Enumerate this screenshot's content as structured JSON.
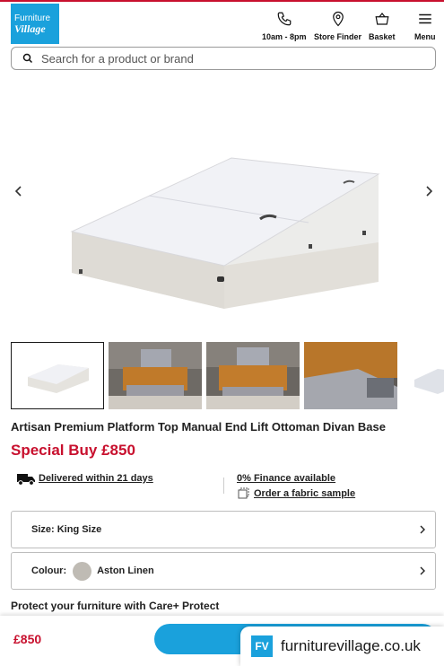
{
  "header": {
    "logo_line1": "Furniture",
    "logo_line2": "Village",
    "phone_label": "10am - 8pm",
    "store_label": "Store Finder",
    "basket_label": "Basket",
    "menu_label": "Menu"
  },
  "search": {
    "placeholder": "Search for a product or brand"
  },
  "product": {
    "title": "Artisan Premium Platform Top Manual End Lift Ottoman Divan Base",
    "price": "Special Buy £850"
  },
  "info": {
    "delivery": "Delivered within 21 days",
    "finance": "0% Finance available",
    "sample": "Order a fabric sample"
  },
  "options": {
    "size": "Size: King Size",
    "colour_label": "Colour:",
    "colour_value": "Aston Linen"
  },
  "protect": "Protect your furniture with Care+ Protect",
  "bottom_bar": {
    "price": "£850"
  },
  "watermark": {
    "badge": "FV",
    "text": "furniturevillage.co.uk"
  },
  "icons": {
    "phone": "phone-icon",
    "store": "location-pin-icon",
    "basket": "basket-icon",
    "menu": "hamburger-menu-icon",
    "search": "search-icon",
    "delivery": "delivery-truck-icon",
    "sample": "fabric-sample-icon"
  },
  "colors": {
    "brand_blue": "#1aa1dc",
    "price_red": "#c8102e",
    "swatch": "#bfbbb4"
  }
}
